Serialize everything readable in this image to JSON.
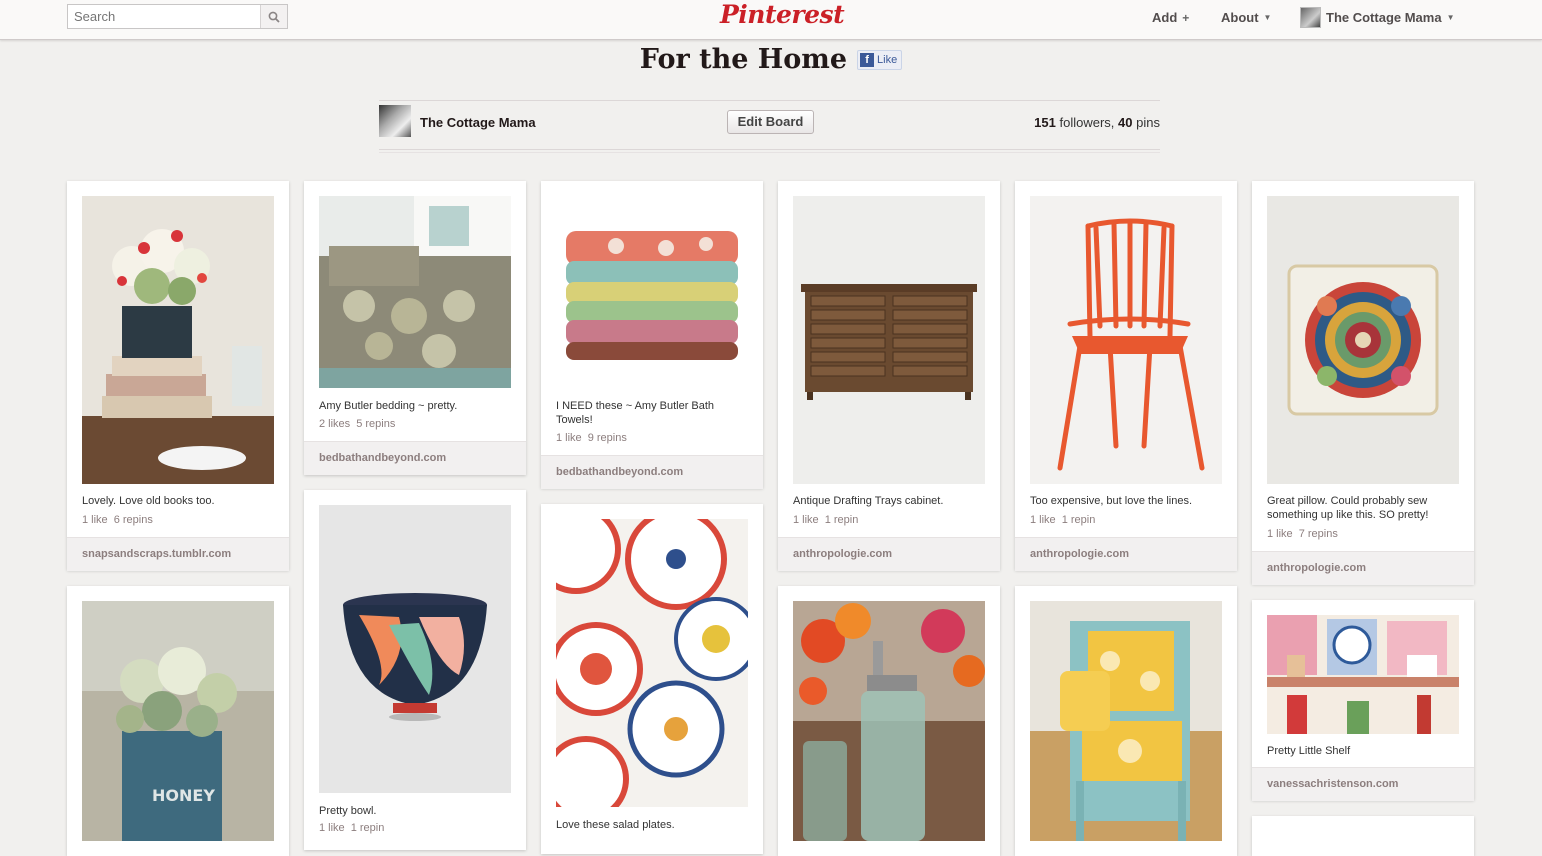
{
  "header": {
    "search_placeholder": "Search",
    "logo": "Pinterest",
    "add_label": "Add",
    "add_icon": "+",
    "about_label": "About",
    "user_name": "The Cottage Mama"
  },
  "board": {
    "title": "For the Home",
    "fb_like": "Like",
    "owner_name": "The Cottage Mama",
    "edit_label": "Edit Board",
    "followers": "151",
    "followers_label": "followers,",
    "pins": "40",
    "pins_label": "pins"
  },
  "pins": [
    {
      "desc": "Lovely. Love old books too.",
      "likes": "1 like",
      "repins": "6 repins",
      "source": "snapsandscraps.tumblr.com"
    },
    {
      "desc": "Amy Butler bedding ~ pretty.",
      "likes": "2 likes",
      "repins": "5 repins",
      "source": "bedbathandbeyond.com"
    },
    {
      "desc": "I NEED these ~ Amy Butler Bath Towels!",
      "likes": "1 like",
      "repins": "9 repins",
      "source": "bedbathandbeyond.com"
    },
    {
      "desc": "Antique Drafting Trays cabinet.",
      "likes": "1 like",
      "repins": "1 repin",
      "source": "anthropologie.com"
    },
    {
      "desc": "Too expensive, but love the lines.",
      "likes": "1 like",
      "repins": "1 repin",
      "source": "anthropologie.com"
    },
    {
      "desc": "Great pillow. Could probably sew something up like this. SO pretty!",
      "likes": "1 like",
      "repins": "7 repins",
      "source": "anthropologie.com"
    },
    {
      "desc": "",
      "likes": "",
      "repins": "",
      "source": ""
    },
    {
      "desc": "Pretty bowl.",
      "likes": "1 like",
      "repins": "1 repin",
      "source": ""
    },
    {
      "desc": "Love these salad plates.",
      "likes": "",
      "repins": "",
      "source": ""
    },
    {
      "desc": "",
      "likes": "",
      "repins": "",
      "source": ""
    },
    {
      "desc": "",
      "likes": "",
      "repins": "",
      "source": ""
    },
    {
      "desc": "Pretty Little Shelf",
      "likes": "",
      "repins": "",
      "source": "vanessachristenson.com"
    }
  ],
  "colors": {
    "brand": "#cb2027",
    "background": "#f1f0ee",
    "source_bar": "#f2f0f0",
    "fb": "#3b5998"
  }
}
